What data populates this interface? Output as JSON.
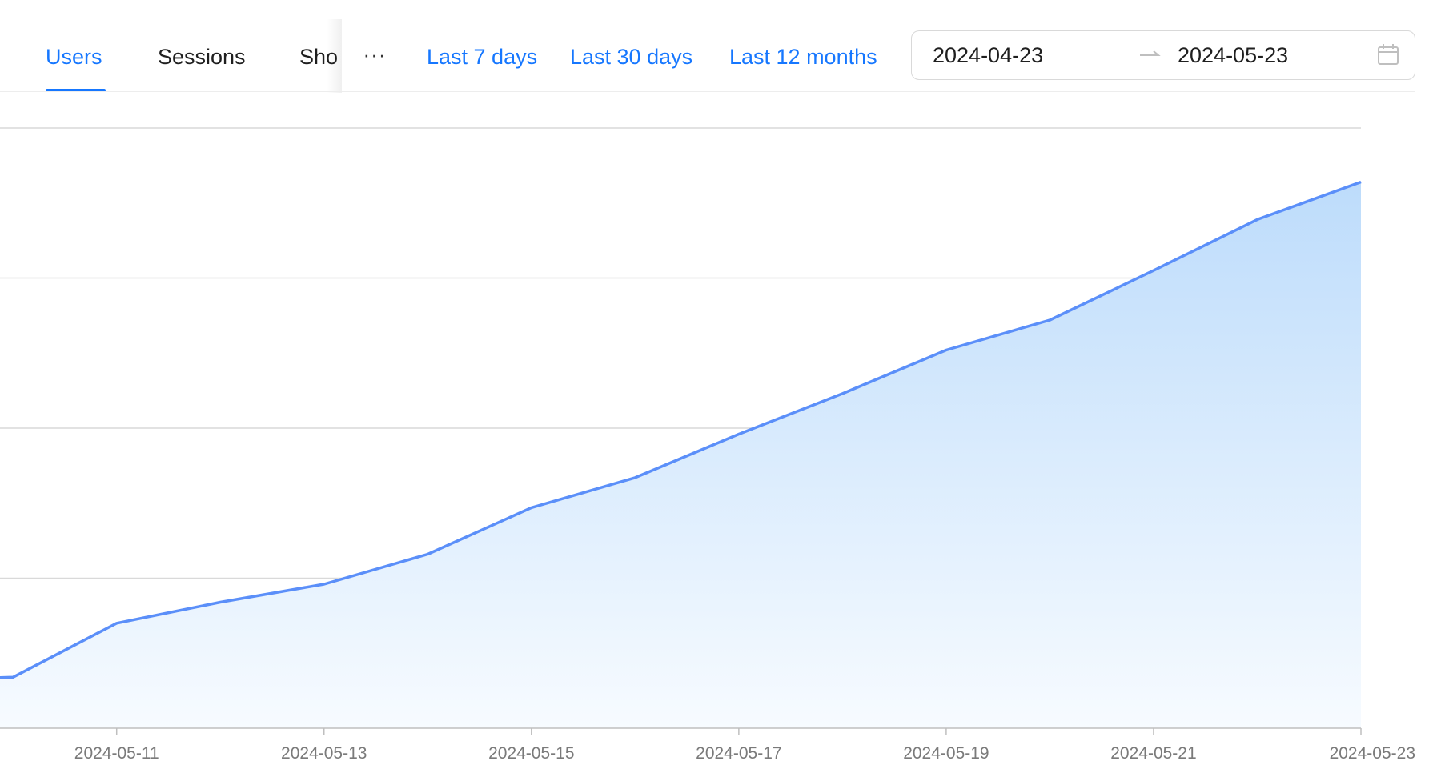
{
  "tabs": [
    {
      "label": "Users",
      "active": true
    },
    {
      "label": "Sessions",
      "active": false
    },
    {
      "label": "Sho",
      "active": false
    }
  ],
  "more_label": "···",
  "quick_ranges": [
    "Last 7 days",
    "Last 30 days",
    "Last 12 months"
  ],
  "date_range": {
    "start": "2024-04-23",
    "end": "2024-05-23"
  },
  "colors": {
    "accent": "#1677ff",
    "line": "#5b8ff9",
    "area_top": "#bddcfb",
    "area_bottom": "#f7fbff",
    "grid": "#d9d9d9",
    "axis": "#bfbfbf"
  },
  "icons": {
    "separator": "swap-right-icon",
    "calendar": "calendar-icon"
  },
  "chart_data": {
    "type": "area",
    "x": [
      "2024-05-09",
      "2024-05-10",
      "2024-05-11",
      "2024-05-12",
      "2024-05-13",
      "2024-05-14",
      "2024-05-15",
      "2024-05-16",
      "2024-05-17",
      "2024-05-18",
      "2024-05-19",
      "2024-05-20",
      "2024-05-21",
      "2024-05-22",
      "2024-05-23"
    ],
    "values": [
      32,
      34,
      70,
      84,
      96,
      116,
      147,
      167,
      196,
      223,
      252,
      272,
      305,
      339,
      364
    ],
    "xticks": [
      "2024-05-11",
      "2024-05-13",
      "2024-05-15",
      "2024-05-17",
      "2024-05-19",
      "2024-05-21",
      "2024-05-23"
    ],
    "xlim": [
      "2024-05-09T21:00",
      "2024-05-23"
    ],
    "ylim": [
      0,
      400
    ],
    "ygrid": [
      100,
      200,
      300,
      400
    ],
    "grid": true,
    "legend": "none"
  }
}
